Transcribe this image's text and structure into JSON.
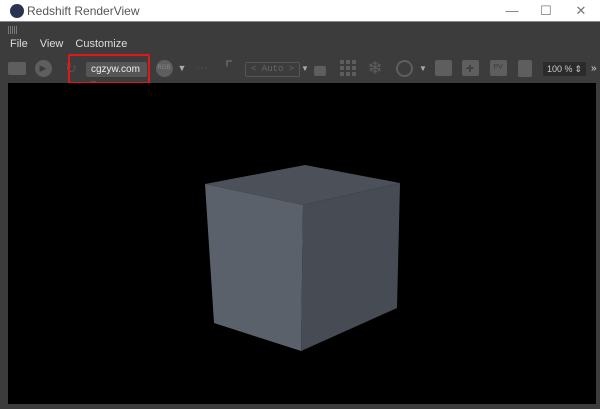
{
  "window": {
    "title": "Redshift RenderView"
  },
  "menu": [
    "File",
    "View",
    "Customize"
  ],
  "toolbar": {
    "camera_select": "cgzyw.com",
    "channel": "RGB",
    "crop_mode": "< Auto >",
    "zoom": "100 %",
    "more": "»"
  },
  "colors": {
    "highlight": "#e01818",
    "background": "#3c3c3c"
  }
}
